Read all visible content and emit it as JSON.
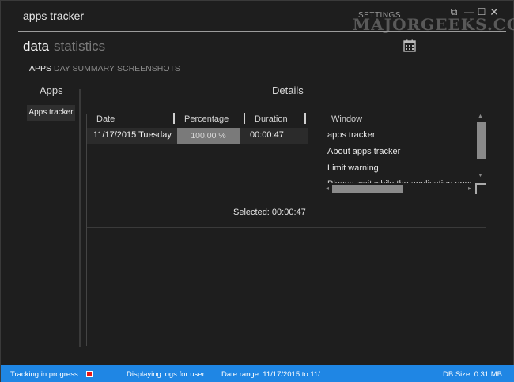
{
  "window": {
    "title": "apps tracker",
    "settings_label": "SETTINGS",
    "watermark": "MAJORGEEKS.COM"
  },
  "controls": {
    "restore": "⧉",
    "minimize": "—",
    "maximize": "☐",
    "close": "✕"
  },
  "pivot": {
    "active": "data",
    "inactive": "statistics"
  },
  "subnav": {
    "apps": "APPS",
    "day_summary": "DAY SUMMARY",
    "screenshots": "SCREENSHOTS"
  },
  "apps_panel": {
    "header": "Apps",
    "items": [
      "Apps tracker"
    ]
  },
  "details": {
    "header": "Details",
    "columns": [
      "Date",
      "Percentage",
      "Duration"
    ],
    "rows": [
      {
        "date": "11/17/2015 Tuesday",
        "percentage": "100.00 %",
        "percentage_value": 100,
        "duration": "00:00:47"
      }
    ],
    "window_header": "Window",
    "windows": [
      "apps tracker",
      "About apps tracker",
      "Limit warning",
      "Please wait while the application opens"
    ],
    "selected": "Selected: 00:00:47"
  },
  "status": {
    "tracking": "Tracking in progress ...",
    "displaying": "Displaying logs for user",
    "date_range": "Date range: 11/17/2015 to 11/",
    "db_size": "DB Size: 0.31 MB",
    "accent": "#1f86e4",
    "stop_color": "#e81818"
  },
  "icons": {
    "calendar": "calendar-icon",
    "stop": "stop-icon"
  }
}
